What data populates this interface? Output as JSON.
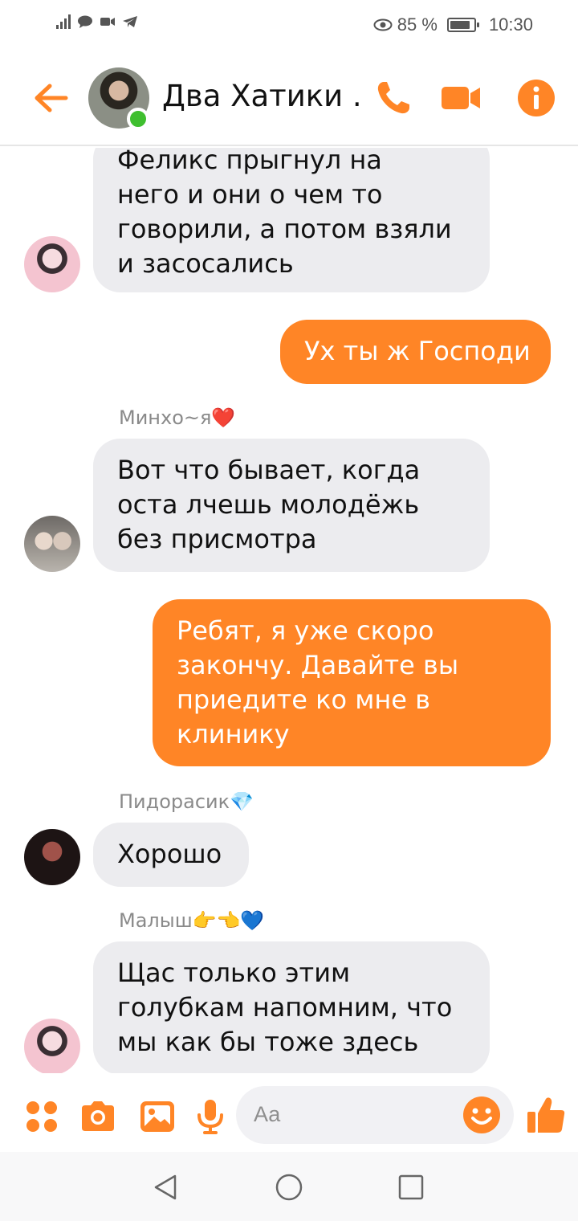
{
  "status_bar": {
    "battery_text": "85 %",
    "battery_level": 0.85,
    "time": "10:30",
    "icons": [
      "signal-icon",
      "message-bubble-icon",
      "video-status-icon",
      "telegram-icon",
      "eye-icon",
      "battery-icon"
    ]
  },
  "header": {
    "title": "Два Хатики ...",
    "online": true,
    "icons": [
      "back-arrow-icon",
      "phone-icon",
      "video-camera-icon",
      "info-icon"
    ]
  },
  "messages": [
    {
      "direction": "incoming",
      "sender": "",
      "lines": [
        "Феликс прыгнул на",
        "него и они о чем то",
        "говорили, а потом взяли",
        "и засосались"
      ]
    },
    {
      "direction": "outgoing",
      "lines": [
        "Ух ты ж Господи"
      ]
    },
    {
      "direction": "incoming",
      "sender": "Минхо~я❤️",
      "lines": [
        "Вот что бывает, когда",
        "оста лчешь молодёжь",
        "без присмотра"
      ]
    },
    {
      "direction": "outgoing",
      "lines": [
        "Ребят, я уже скоро",
        "закончу. Давайте вы",
        "приедите ко мне в",
        "клинику"
      ]
    },
    {
      "direction": "incoming",
      "sender": "Пидорасик💎",
      "lines": [
        "Хорошо"
      ]
    },
    {
      "direction": "incoming",
      "sender": "Малыш👉👈💙",
      "lines": [
        "Щас только этим",
        "голубкам напомним, что",
        "мы как бы тоже здесь"
      ]
    }
  ],
  "composer": {
    "placeholder": "Аа",
    "icons": [
      "apps-grid-icon",
      "camera-icon",
      "gallery-icon",
      "microphone-icon",
      "emoji-icon",
      "thumbs-up-icon"
    ]
  },
  "colors": {
    "accent": "#ff8526",
    "incoming_bubble": "#ececef",
    "online": "#3fbf2f"
  },
  "nav_bar": {
    "icons": [
      "nav-back-icon",
      "nav-home-icon",
      "nav-recents-icon"
    ]
  }
}
